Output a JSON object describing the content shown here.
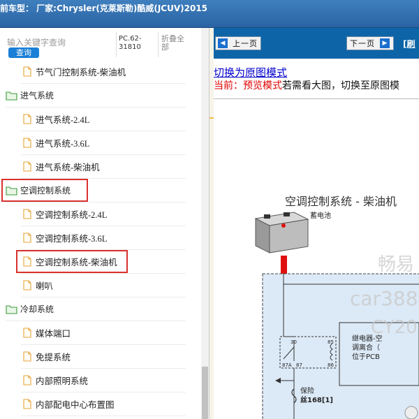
{
  "title_bar": {
    "text": "前车型：  厂家:Chrysler(克莱斯勒)酷威(JCUV)2015"
  },
  "search": {
    "placeholder": "输入关键字查询",
    "button_label": "查询"
  },
  "code": "PC.62-31810",
  "collapse_label": "折叠全部",
  "tree": [
    {
      "type": "leaf",
      "label": "节气门控制系统-柴油机"
    },
    {
      "type": "folder",
      "label": "进气系统"
    },
    {
      "type": "leaf",
      "label": "进气系统-2.4L"
    },
    {
      "type": "leaf",
      "label": "进气系统-3.6L"
    },
    {
      "type": "leaf",
      "label": "进气系统-柴油机"
    },
    {
      "type": "folder",
      "label": "空调控制系统",
      "highlighted": true
    },
    {
      "type": "leaf",
      "label": "空调控制系统-2.4L"
    },
    {
      "type": "leaf",
      "label": "空调控制系统-3.6L"
    },
    {
      "type": "leaf",
      "label": "空调控制系统-柴油机",
      "highlighted": true
    },
    {
      "type": "leaf",
      "label": "喇叭"
    },
    {
      "type": "folder",
      "label": "冷却系统"
    },
    {
      "type": "leaf",
      "label": "媒体端口"
    },
    {
      "type": "leaf",
      "label": "免提系统"
    },
    {
      "type": "leaf",
      "label": "内部照明系统"
    },
    {
      "type": "leaf",
      "label": "内部配电中心布置图"
    }
  ],
  "nav": {
    "prev_label": "上一页",
    "next_label": "下一页",
    "refresh_link": "[刷"
  },
  "mode": {
    "link": "切换为原图模式",
    "current_prefix": "当前：预览模式",
    "current_suffix": "若需看大图，切换至原图模"
  },
  "diagram": {
    "title": "空调控制系统 - 柴油机",
    "battery_label": "蓄电池",
    "relay_label_line1": "继电器-空",
    "relay_label_line2": "调离合（",
    "relay_label_line3": "位于PCB",
    "pin_30": "30",
    "pin_87a": "87A",
    "pin_87": "87",
    "pin_85": "85",
    "pin_86": "86",
    "fuse_label_line1": "保险",
    "fuse_label_line2": "丝168[1]",
    "watermark_1": "畅易",
    "watermark_2": "car388.",
    "watermark_3": "CY20"
  },
  "colors": {
    "highlight": "#d9312e",
    "nav_bar": "#0d65a7",
    "diagram_fill": "#dce9f6",
    "wire_red": "#e01010"
  }
}
